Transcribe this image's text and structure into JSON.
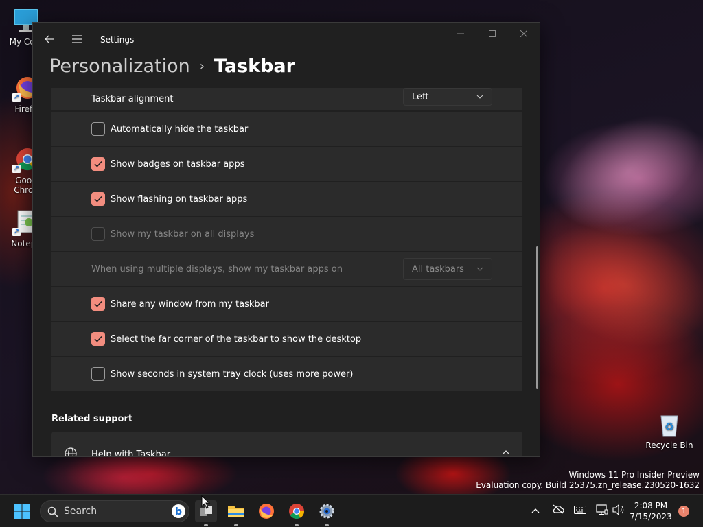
{
  "desktop": {
    "icons": [
      {
        "label": "My Com"
      },
      {
        "label": "Firefo"
      },
      {
        "label1": "Goog",
        "label2": "Chron"
      },
      {
        "label": "Notepa"
      }
    ],
    "recycle_bin": "Recycle Bin"
  },
  "window": {
    "app_title": "Settings",
    "breadcrumb": {
      "parent": "Personalization",
      "separator": "›",
      "current": "Taskbar"
    },
    "rows": [
      {
        "label": "Taskbar alignment",
        "dropdown": "Left"
      },
      {
        "label": "Automatically hide the taskbar",
        "checked": false
      },
      {
        "label": "Show badges on taskbar apps",
        "checked": true
      },
      {
        "label": "Show flashing on taskbar apps",
        "checked": true
      },
      {
        "label": "Show my taskbar on all displays",
        "checked": false,
        "disabled": true
      },
      {
        "label": "When using multiple displays, show my taskbar apps on",
        "dropdown": "All taskbars",
        "disabled": true
      },
      {
        "label": "Share any window from my taskbar",
        "checked": true
      },
      {
        "label": "Select the far corner of the taskbar to show the desktop",
        "checked": true
      },
      {
        "label": "Show seconds in system tray clock (uses more power)",
        "checked": false
      }
    ],
    "related_support": "Related support",
    "help_row": "Help with Taskbar"
  },
  "watermark": {
    "line1": "Windows 11 Pro Insider Preview",
    "line2": "Evaluation copy. Build 25375.zn_release.230520-1632"
  },
  "taskbar": {
    "search_placeholder": "Search",
    "clock_time": "2:08 PM",
    "clock_date": "7/15/2023",
    "notification_count": "1"
  },
  "colors": {
    "accent": "#f28d7f",
    "window_bg": "#202020",
    "row_bg": "#2b2b2b"
  }
}
